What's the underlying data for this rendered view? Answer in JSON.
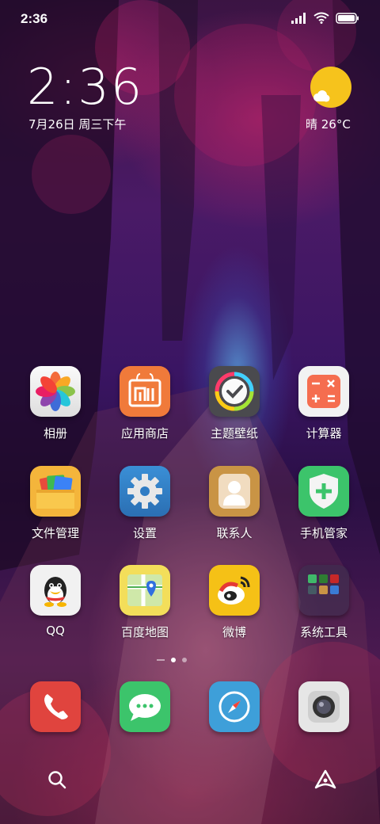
{
  "status_bar": {
    "time": "2:36"
  },
  "clock_widget": {
    "time": "2:36",
    "date": "7月26日 周三下午"
  },
  "weather_widget": {
    "text": "晴 26°C",
    "icon": "sunny-icon"
  },
  "apps": [
    {
      "label": "相册",
      "icon": "gallery-icon"
    },
    {
      "label": "应用商店",
      "icon": "app-store-icon"
    },
    {
      "label": "主题壁纸",
      "icon": "themes-icon"
    },
    {
      "label": "计算器",
      "icon": "calculator-icon"
    },
    {
      "label": "文件管理",
      "icon": "file-manager-icon"
    },
    {
      "label": "设置",
      "icon": "settings-icon"
    },
    {
      "label": "联系人",
      "icon": "contacts-icon"
    },
    {
      "label": "手机管家",
      "icon": "security-icon"
    },
    {
      "label": "QQ",
      "icon": "qq-icon"
    },
    {
      "label": "百度地图",
      "icon": "map-icon"
    },
    {
      "label": "微博",
      "icon": "weibo-icon"
    },
    {
      "label": "系统工具",
      "icon": "folder-icon"
    }
  ],
  "dock": [
    {
      "icon": "phone-icon"
    },
    {
      "icon": "messages-icon"
    },
    {
      "icon": "browser-icon"
    },
    {
      "icon": "camera-icon"
    }
  ],
  "page_indicator": {
    "pages": 2,
    "active": 1
  },
  "colors": {
    "sun": "#f6c31c",
    "text": "#ffffff"
  }
}
